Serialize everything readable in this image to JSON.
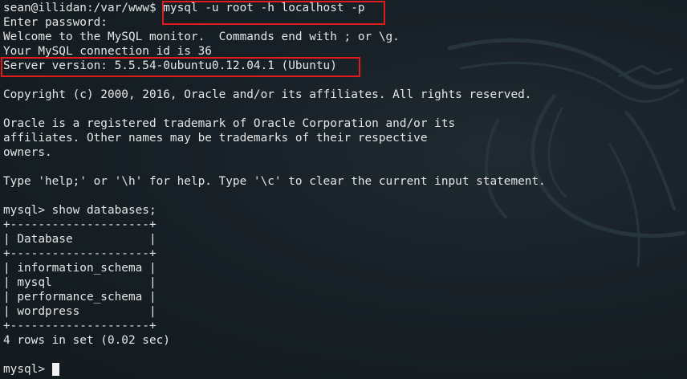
{
  "terminal": {
    "lines": [
      "sean@illidan:/var/www$ mysql -u root -h localhost -p",
      "Enter password:",
      "Welcome to the MySQL monitor.  Commands end with ; or \\g.",
      "Your MySQL connection id is 36",
      "Server version: 5.5.54-0ubuntu0.12.04.1 (Ubuntu)",
      "",
      "Copyright (c) 2000, 2016, Oracle and/or its affiliates. All rights reserved.",
      "",
      "Oracle is a registered trademark of Oracle Corporation and/or its",
      "affiliates. Other names may be trademarks of their respective",
      "owners.",
      "",
      "Type 'help;' or '\\h' for help. Type '\\c' to clear the current input statement.",
      "",
      "mysql> show databases;",
      "+--------------------+",
      "| Database           |",
      "+--------------------+",
      "| information_schema |",
      "| mysql              |",
      "| performance_schema |",
      "| wordpress          |",
      "+--------------------+",
      "4 rows in set (0.02 sec)",
      ""
    ],
    "current_prompt": "mysql>"
  },
  "colors": {
    "text": "#e6e6e6",
    "highlight_box": "#e01b1b",
    "background": "#141a1f"
  },
  "decoration": {
    "background_icon": "kali-dragon-icon"
  }
}
